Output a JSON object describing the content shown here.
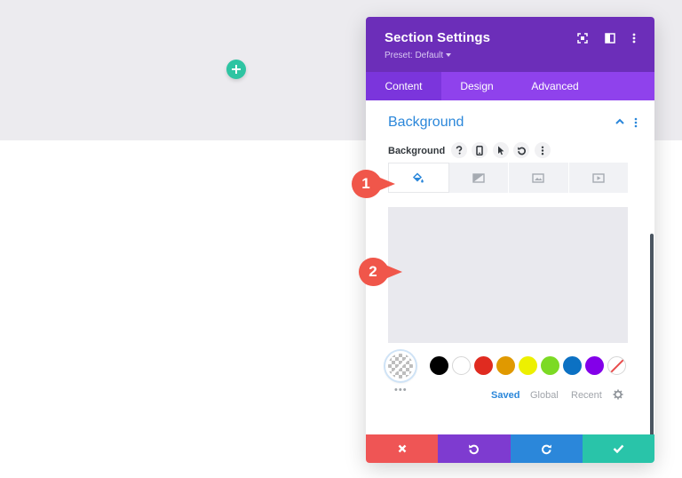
{
  "modal": {
    "title": "Section Settings",
    "preset": "Preset: Default",
    "tabs": [
      {
        "label": "Content",
        "active": true
      },
      {
        "label": "Design",
        "active": false
      },
      {
        "label": "Advanced",
        "active": false
      }
    ]
  },
  "section": {
    "title": "Background",
    "field_label": "Background",
    "background_tabs": [
      "color-fill-icon",
      "gradient-icon",
      "image-icon",
      "video-icon"
    ],
    "active_background_tab": 0
  },
  "palette": {
    "more_label": "•••",
    "colors": [
      "#000000",
      "#ffffff",
      "#e02b20",
      "#e09900",
      "#edf000",
      "#7cda24",
      "#0c71c3",
      "#8300e9"
    ],
    "tabs": [
      {
        "label": "Saved",
        "active": true
      },
      {
        "label": "Global",
        "active": false
      },
      {
        "label": "Recent",
        "active": false
      }
    ]
  },
  "footer": {
    "buttons": [
      {
        "name": "cancel",
        "color": "#ef5555",
        "icon": "close-icon"
      },
      {
        "name": "undo",
        "color": "#7e3bd0",
        "icon": "undo-icon"
      },
      {
        "name": "redo",
        "color": "#2b87da",
        "icon": "redo-icon"
      },
      {
        "name": "save",
        "color": "#29c4a9",
        "icon": "check-icon"
      }
    ]
  },
  "callouts": [
    "1",
    "2"
  ],
  "colors": {
    "header": "#6c2eb9",
    "tab_bar": "#8f42ec",
    "accent": "#2b87da",
    "add_button": "#2ec4a2",
    "callout": "#f0564a"
  }
}
